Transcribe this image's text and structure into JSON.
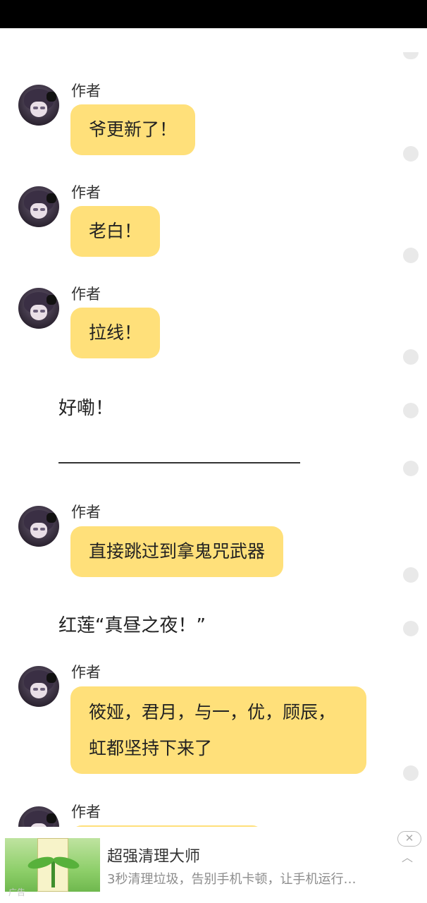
{
  "messages": [
    {
      "author": "作者",
      "text": "爷更新了！"
    },
    {
      "author": "作者",
      "text": "老白！"
    },
    {
      "author": "作者",
      "text": "拉线！"
    },
    {
      "plain": "好嘞！"
    },
    {
      "author": "作者",
      "text": "直接跳过到拿鬼咒武器"
    },
    {
      "plain": "红莲“真昼之夜！”"
    },
    {
      "author": "作者",
      "text": "筱娅，君月，与一，优，顾辰，虹都坚持下来了"
    },
    {
      "author": "作者",
      "text": ""
    }
  ],
  "ad": {
    "title": "超强清理大师",
    "description": "3秒清理垃圾，告别手机卡顿，让手机运行…",
    "close_icon": "close-icon",
    "label": "广告"
  },
  "colors": {
    "bubble": "#ffe07a",
    "status_bar": "#000000"
  }
}
